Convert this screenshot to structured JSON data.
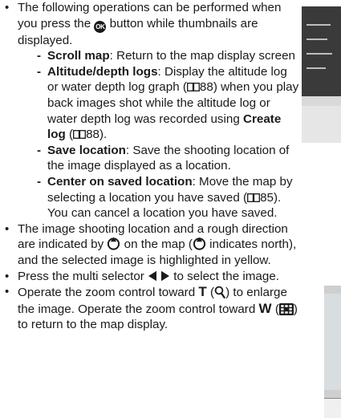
{
  "bullets": [
    {
      "lines": [
        "The following operations can be performed",
        "when you press the",
        "button while",
        "thumbnails are displayed."
      ],
      "ok_icon_label": "OK",
      "subitems": [
        {
          "term": "Scroll map",
          "desc": ": Return to the map display screen"
        },
        {
          "term": "Altitude/depth logs",
          "desc_parts": [
            ": Display the altitude log or water depth log graph (",
            "88) when you play back images shot while the altitude log or water depth log was recorded using "
          ],
          "term2": "Create log",
          "desc_tail": " (",
          "ref_tail": "88)."
        },
        {
          "term": "Save location",
          "desc": ": Save the shooting location of the image displayed as a location."
        },
        {
          "term": "Center on saved location",
          "desc_parts": [
            ": Move the map by selecting a location you have saved (",
            "85). You can cancel a location you have saved."
          ]
        }
      ]
    },
    {
      "parts": [
        "The image shooting location and a rough direction are indicated by ",
        " on the map (",
        " indicates north), and the selected image is highlighted in yellow."
      ]
    },
    {
      "parts": [
        "Press the multi selector ",
        " to select the image."
      ]
    },
    {
      "parts": [
        "Operate the zoom control toward ",
        " (",
        ") to enlarge the image. Operate the zoom control toward ",
        " (",
        ") to return to the map display."
      ],
      "T": "T",
      "W": "W"
    }
  ],
  "icons": [
    "ok-button-icon",
    "reference-book-icon",
    "direction-indicator-icon",
    "multi-selector-arrows-icon",
    "playback-zoom-icon",
    "thumbnail-icon"
  ]
}
